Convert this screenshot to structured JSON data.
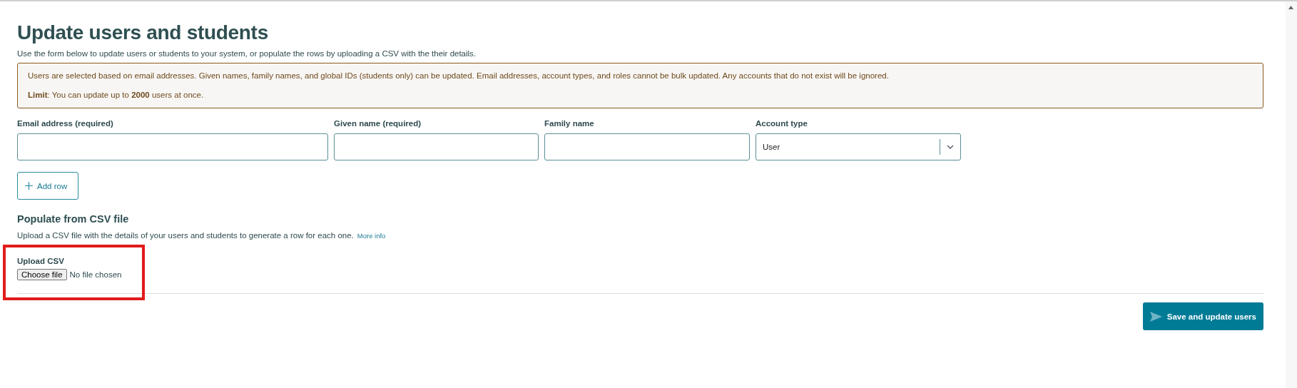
{
  "title": "Update users and students",
  "intro": "Use the form below to update users or students to your system, or populate the rows by uploading a CSV with the their details.",
  "alert": {
    "message": "Users are selected based on email addresses. Given names, family names, and global IDs (students only) can be updated. Email addresses, account types, and roles cannot be bulk updated. Any accounts that do not exist will be ignored.",
    "limit": "**Limit**: You can update up to **2000** users at once."
  },
  "fields": [
    {
      "kind": "text",
      "label": "Email address (required)"
    },
    {
      "kind": "text",
      "label": "Given name (required)"
    },
    {
      "kind": "text",
      "label": "Family name"
    },
    {
      "kind": "select",
      "label": "Account type",
      "value": "User"
    }
  ],
  "add_row_button": "Add row",
  "csv": {
    "heading": "Populate from CSV file",
    "description": "Upload a CSV file with the details of your users and students to generate a row for each one.",
    "link": "More info",
    "upload_label": "Upload CSV",
    "choose_button": "Choose file",
    "file_status": "No file chosen"
  },
  "submit_button": "Save and update users"
}
